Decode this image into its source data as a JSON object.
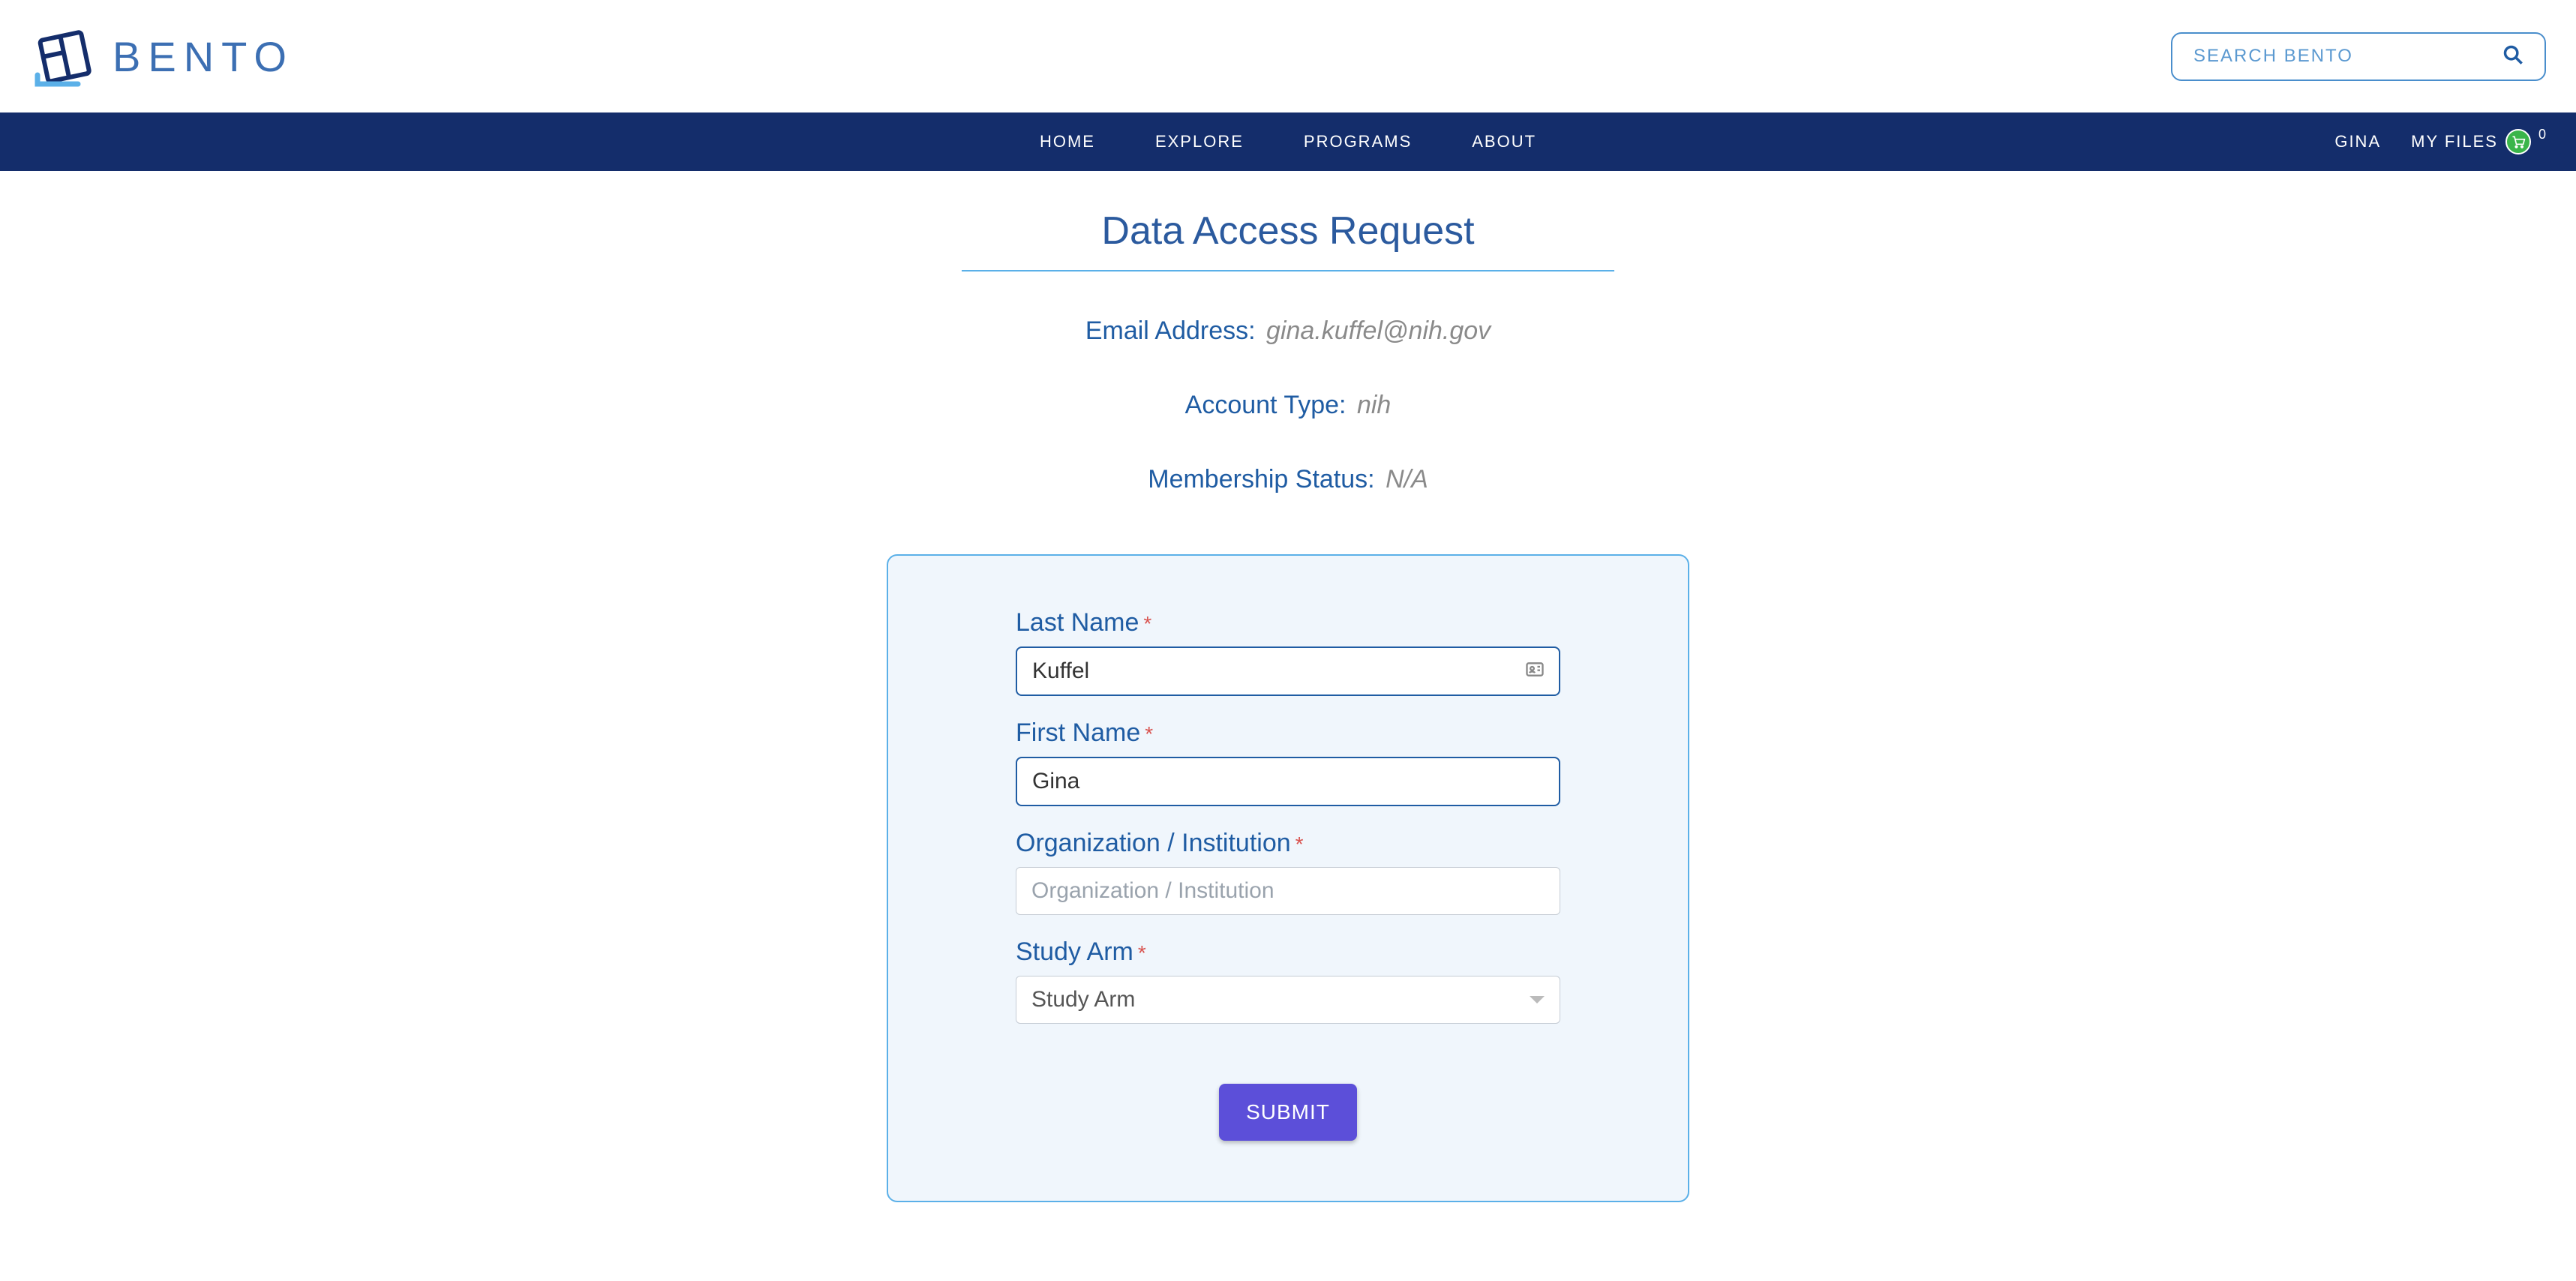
{
  "header": {
    "brand": "BENTO",
    "search_placeholder": "SEARCH BENTO"
  },
  "nav": {
    "items": [
      "HOME",
      "EXPLORE",
      "PROGRAMS",
      "ABOUT"
    ],
    "user": "GINA",
    "files_label": "MY FILES",
    "cart_count": "0"
  },
  "page": {
    "title": "Data Access Request"
  },
  "info": {
    "email_label": "Email Address:",
    "email_value": "gina.kuffel@nih.gov",
    "account_type_label": "Account Type:",
    "account_type_value": "nih",
    "membership_label": "Membership Status:",
    "membership_value": "N/A"
  },
  "form": {
    "last_name_label": "Last Name",
    "last_name_value": "Kuffel",
    "first_name_label": "First Name",
    "first_name_value": "Gina",
    "org_label": "Organization / Institution",
    "org_placeholder": "Organization / Institution",
    "org_value": "",
    "study_arm_label": "Study Arm",
    "study_arm_selected": "Study Arm",
    "submit_label": "SUBMIT"
  }
}
